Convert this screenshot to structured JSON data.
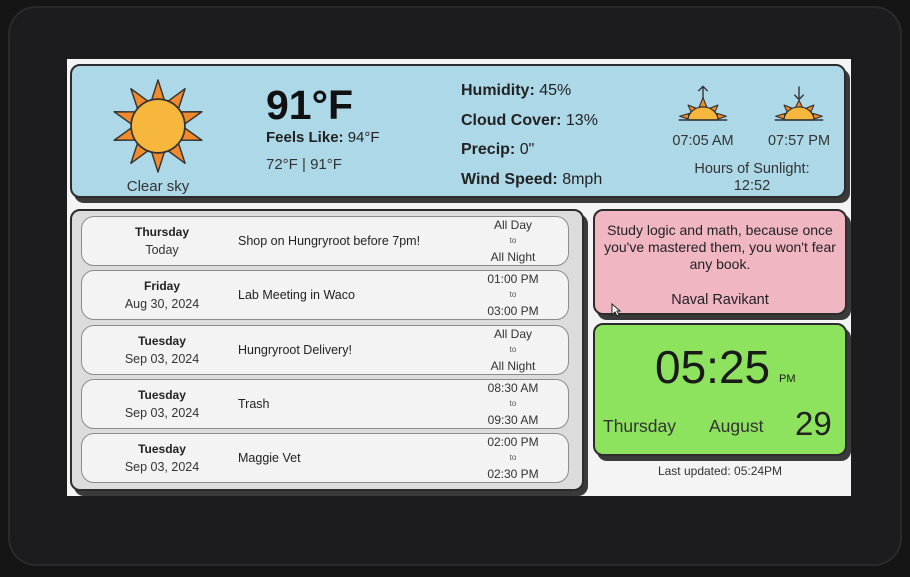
{
  "weather": {
    "condition": "Clear sky",
    "temperature": "91°F",
    "feels_like_label": "Feels Like:",
    "feels_like_value": "94°F",
    "hilo": "72°F | 91°F",
    "humidity_label": "Humidity:",
    "humidity_value": "45%",
    "cloud_label": "Cloud Cover:",
    "cloud_value": "13%",
    "precip_label": "Precip:",
    "precip_value": "0\"",
    "wind_label": "Wind Speed:",
    "wind_value": "8mph",
    "sunrise": "07:05 AM",
    "sunset": "07:57 PM",
    "sunlight_label": "Hours of Sunlight:",
    "sunlight_value": "12:52",
    "icons": {
      "condition": "sun-icon",
      "sunrise": "sunrise-icon",
      "sunset": "sunset-icon"
    },
    "colors": {
      "panel": "#acd8e8",
      "sun": "#f6b73c",
      "rays": "#f08a2c"
    }
  },
  "events": [
    {
      "day": "Thursday",
      "date": "Today",
      "title": "Shop on Hungryroot before 7pm!",
      "start": "All Day",
      "to": "to",
      "end": "All Night"
    },
    {
      "day": "Friday",
      "date": "Aug 30, 2024",
      "title": "Lab Meeting in Waco",
      "start": "01:00 PM",
      "to": "to",
      "end": "03:00 PM"
    },
    {
      "day": "Tuesday",
      "date": "Sep 03, 2024",
      "title": "Hungryroot Delivery!",
      "start": "All Day",
      "to": "to",
      "end": "All Night"
    },
    {
      "day": "Tuesday",
      "date": "Sep 03, 2024",
      "title": "Trash",
      "start": "08:30 AM",
      "to": "to",
      "end": "09:30 AM"
    },
    {
      "day": "Tuesday",
      "date": "Sep 03, 2024",
      "title": "Maggie Vet",
      "start": "02:00 PM",
      "to": "to",
      "end": "02:30 PM"
    }
  ],
  "quote": {
    "text": "Study logic and math, because once you've mastered them, you won't fear any book.",
    "author": "Naval Ravikant",
    "color": "#f0b6c2"
  },
  "clock": {
    "time": "05:25",
    "ampm": "PM",
    "weekday": "Thursday",
    "month": "August",
    "day": "29",
    "color": "#8de25e"
  },
  "footer": {
    "last_updated": "Last updated: 05:24PM"
  }
}
